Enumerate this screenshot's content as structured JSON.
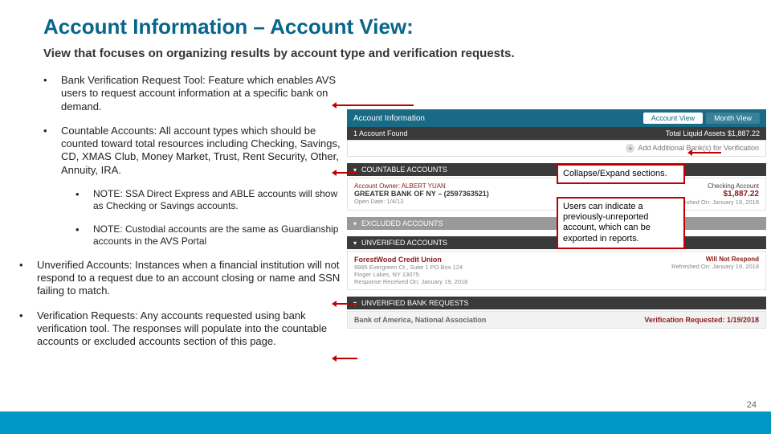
{
  "title": "Account Information – Account View:",
  "subtitle": "View that focuses on organizing results by account type and verification requests.",
  "bullets": {
    "b1": "Bank Verification Request Tool: Feature which enables AVS users to request account information at a specific bank on demand.",
    "b2": "Countable Accounts: All account types which should be counted toward total resources including Checking, Savings, CD, XMAS Club, Money Market, Trust, Rent Security, Other, Annuity, IRA.",
    "b2a": "NOTE: SSA Direct Express and ABLE accounts will show as Checking or Savings accounts.",
    "b2b": "NOTE: Custodial accounts are the same as Guardianship accounts in the AVS Portal",
    "b3": "Unverified Accounts: Instances when a financial institution will not respond to a request due to an account closing or name and SSN failing to match.",
    "b4": "Verification Requests: Any accounts requested using bank verification tool.  The responses will populate into the countable accounts or excluded accounts section of this page."
  },
  "callouts": {
    "c1": "Collapse/Expand sections.",
    "c2": "Users can indicate a previously-unreported account, which can be exported in reports."
  },
  "shot": {
    "header": "Account Information",
    "tab_active": "Account View",
    "tab_other": "Month View",
    "found": "1 Account Found",
    "total": "Total Liquid Assets $1,887.22",
    "add": "Add Additional Bank(s) for Verification",
    "sec_countable": "COUNTABLE ACCOUNTS",
    "countable": {
      "owner": "Account Owner: ALBERT YUAN",
      "bank": "GREATER BANK OF NY – (2597363521)",
      "date": "Open Date: 1/4/13",
      "type": "Checking Account",
      "amount": "$1,887.22",
      "ref": "Refreshed On: January 19, 2018"
    },
    "sec_excluded": "EXCLUDED ACCOUNTS",
    "sec_unverified": "UNVERIFIED ACCOUNTS",
    "unverified": {
      "bank": "ForestWood Credit Union",
      "line2": "9985 Evergreen Ct., Suite 1 PO Box 124",
      "line3": "Finger Lakes, NY 13075",
      "date": "Response Received On: January 19, 2018",
      "status": "Will Not Respond",
      "ref": "Refreshed On: January 19, 2018"
    },
    "sec_requests": "UNVERIFIED BANK REQUESTS",
    "request": {
      "bank": "Bank of America, National Association",
      "status": "Verification Requested: 1/19/2018"
    }
  },
  "page_number": "24"
}
